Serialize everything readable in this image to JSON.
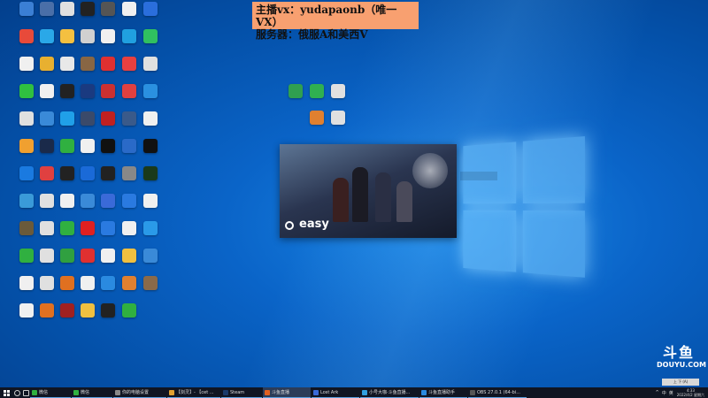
{
  "banner": {
    "line1": "主播vx：yudapaonb（唯一VX）",
    "line2": "服务器：俄服A和美西V"
  },
  "splash": {
    "brand": "easy"
  },
  "watermark": {
    "mark": "斗鱼",
    "text": "DOUYU.COM"
  },
  "desktop_icons": [
    {
      "label": "",
      "color": "#3b7fd4"
    },
    {
      "label": "",
      "color": "#4a6fa8"
    },
    {
      "label": "",
      "color": "#e0e0e0"
    },
    {
      "label": "",
      "color": "#222222"
    },
    {
      "label": "",
      "color": "#555555"
    },
    {
      "label": "",
      "color": "#f0f0f0"
    },
    {
      "label": "",
      "color": "#2a6edc"
    },
    {
      "label": "",
      "color": "#e84a3a"
    },
    {
      "label": "",
      "color": "#2aa8e8"
    },
    {
      "label": "",
      "color": "#f4c040"
    },
    {
      "label": "",
      "color": "#d0d0d0"
    },
    {
      "label": "",
      "color": "#f0f0f0"
    },
    {
      "label": "",
      "color": "#20a0e0"
    },
    {
      "label": "",
      "color": "#30c060"
    },
    {
      "label": "",
      "color": "#f0f0f0"
    },
    {
      "label": "",
      "color": "#e8b030"
    },
    {
      "label": "",
      "color": "#e8e8e8"
    },
    {
      "label": "",
      "color": "#886644"
    },
    {
      "label": "",
      "color": "#e03030"
    },
    {
      "label": "",
      "color": "#e84040"
    },
    {
      "label": "",
      "color": "#e0e0e0"
    },
    {
      "label": "",
      "color": "#30c040"
    },
    {
      "label": "",
      "color": "#f0f0f0"
    },
    {
      "label": "",
      "color": "#222222"
    },
    {
      "label": "",
      "color": "#1a3a80"
    },
    {
      "label": "",
      "color": "#cc3030"
    },
    {
      "label": "",
      "color": "#e04040"
    },
    {
      "label": "",
      "color": "#2a90e0"
    },
    {
      "label": "",
      "color": "#e0e0e0"
    },
    {
      "label": "",
      "color": "#3a8ad8"
    },
    {
      "label": "",
      "color": "#20a0e8"
    },
    {
      "label": "",
      "color": "#3a4a6a"
    },
    {
      "label": "",
      "color": "#c02020"
    },
    {
      "label": "",
      "color": "#3a5a8a"
    },
    {
      "label": "",
      "color": "#f0f0f0"
    },
    {
      "label": "",
      "color": "#f0a030"
    },
    {
      "label": "",
      "color": "#1a2a4a"
    },
    {
      "label": "",
      "color": "#30b040"
    },
    {
      "label": "",
      "color": "#f0f0f0"
    },
    {
      "label": "",
      "color": "#111111"
    },
    {
      "label": "",
      "color": "#2a6ac8"
    },
    {
      "label": "",
      "color": "#111111"
    },
    {
      "label": "",
      "color": "#1a7ae0"
    },
    {
      "label": "",
      "color": "#e04040"
    },
    {
      "label": "",
      "color": "#222222"
    },
    {
      "label": "",
      "color": "#1a6ad8"
    },
    {
      "label": "",
      "color": "#222222"
    },
    {
      "label": "",
      "color": "#888888"
    },
    {
      "label": "",
      "color": "#1a3a1a"
    },
    {
      "label": "",
      "color": "#3a9ad8"
    },
    {
      "label": "",
      "color": "#e0e0e0"
    },
    {
      "label": "",
      "color": "#f0f0f0"
    },
    {
      "label": "",
      "color": "#3a8ad8"
    },
    {
      "label": "",
      "color": "#3a6ad8"
    },
    {
      "label": "",
      "color": "#2a7ae0"
    },
    {
      "label": "",
      "color": "#f0f0f0"
    },
    {
      "label": "",
      "color": "#6a5a3a"
    },
    {
      "label": "",
      "color": "#e0e0e0"
    },
    {
      "label": "",
      "color": "#30b040"
    },
    {
      "label": "",
      "color": "#e02020"
    },
    {
      "label": "",
      "color": "#2a7ae0"
    },
    {
      "label": "",
      "color": "#f0f0f0"
    },
    {
      "label": "",
      "color": "#2a9ae8"
    },
    {
      "label": "",
      "color": "#30b040"
    },
    {
      "label": "",
      "color": "#e0e0e0"
    },
    {
      "label": "",
      "color": "#30a040"
    },
    {
      "label": "",
      "color": "#e03030"
    },
    {
      "label": "",
      "color": "#f0f0f0"
    },
    {
      "label": "",
      "color": "#f0c040"
    },
    {
      "label": "",
      "color": "#3a8ad8"
    },
    {
      "label": "",
      "color": "#f0f0f0"
    },
    {
      "label": "",
      "color": "#e0e0e0"
    },
    {
      "label": "",
      "color": "#e07020"
    },
    {
      "label": "",
      "color": "#f0f0f0"
    },
    {
      "label": "",
      "color": "#2a8ae0"
    },
    {
      "label": "",
      "color": "#e08030"
    },
    {
      "label": "",
      "color": "#8a6a4a"
    },
    {
      "label": "",
      "color": "#f0f0f0"
    },
    {
      "label": "",
      "color": "#e07020"
    },
    {
      "label": "",
      "color": "#a02020"
    },
    {
      "label": "",
      "color": "#f0c040"
    },
    {
      "label": "",
      "color": "#222222"
    },
    {
      "label": "",
      "color": "#30b040"
    }
  ],
  "center_icons": [
    {
      "label": "",
      "color": "#30a050"
    },
    {
      "label": "",
      "color": "#30b050"
    },
    {
      "label": "",
      "color": "#e0e0e0"
    },
    {
      "label": "",
      "color": "#e08030"
    },
    {
      "label": "",
      "color": "#e0e0e0"
    }
  ],
  "taskbar": {
    "search_icon": "search-icon",
    "apps": [
      {
        "label": "微信",
        "color": "#30b040"
      },
      {
        "label": "微信",
        "color": "#30b040"
      },
      {
        "label": "你的电脑设置",
        "color": "#888888"
      },
      {
        "label": "【剑灵】- 【cet ...",
        "color": "#e0a030"
      },
      {
        "label": "Steam",
        "color": "#1a3a6a"
      },
      {
        "label": "斗鱼直播",
        "color": "#e06020"
      },
      {
        "label": "Lost Ark",
        "color": "#3a6ad8"
      },
      {
        "label": "小号大咖·斗鱼直播...",
        "color": "#30a0e0"
      },
      {
        "label": "斗鱼直播助手",
        "color": "#2a8ae0"
      },
      {
        "label": "OBS 27.0.1 (64-bi...",
        "color": "#555555"
      }
    ],
    "tray": [
      "^",
      "中",
      "英"
    ],
    "clock_time": "4:33",
    "clock_date": "2022/4/2 星期六"
  },
  "tray_popup": "上  下  (A)"
}
